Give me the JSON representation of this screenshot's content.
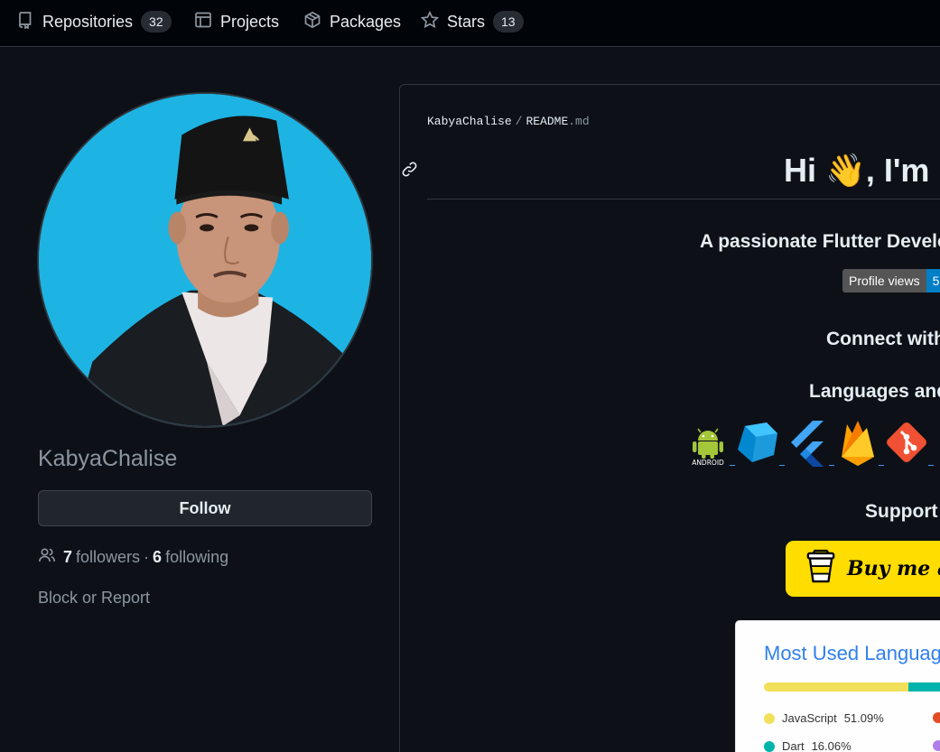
{
  "nav": {
    "tabs": [
      {
        "label": "Repositories",
        "count": "32",
        "icon": "repo-icon"
      },
      {
        "label": "Projects",
        "count": null,
        "icon": "table-icon"
      },
      {
        "label": "Packages",
        "count": null,
        "icon": "package-icon"
      },
      {
        "label": "Stars",
        "count": "13",
        "icon": "star-icon"
      }
    ]
  },
  "profile": {
    "username": "KabyaChalise",
    "follow_label": "Follow",
    "followers_count": "7",
    "followers_label": "followers",
    "separator": "·",
    "following_count": "6",
    "following_label": "following",
    "block_label": "Block or Report"
  },
  "readme": {
    "owner": "KabyaChalise",
    "sep": "/",
    "file": "README",
    "ext": ".md",
    "greeting": "Hi 👋, I'm",
    "tagline": "A passionate Flutter Develo",
    "badge_label": "Profile views",
    "badge_value": "5",
    "connect_heading": "Connect with",
    "languages_heading": "Languages and",
    "icons": [
      "android-icon",
      "dart-icon",
      "flutter-icon",
      "firebase-icon",
      "git-icon"
    ],
    "support_heading": "Support",
    "bmc_label": "Buy me a"
  },
  "lang_card": {
    "title": "Most Used Languag",
    "items": [
      {
        "name": "JavaScript",
        "percent": "51.09%",
        "color": "#f1e05a"
      },
      {
        "name": "Dart",
        "percent": "16.06%",
        "color": "#00b4ab"
      }
    ]
  },
  "colors": {
    "bg": "#0d1117",
    "nav_bg": "#010409",
    "border": "#30363d",
    "text": "#e6edf3",
    "muted": "#8d96a0",
    "accent_link": "#2f80ed",
    "bmc_yellow": "#ffdd00"
  }
}
